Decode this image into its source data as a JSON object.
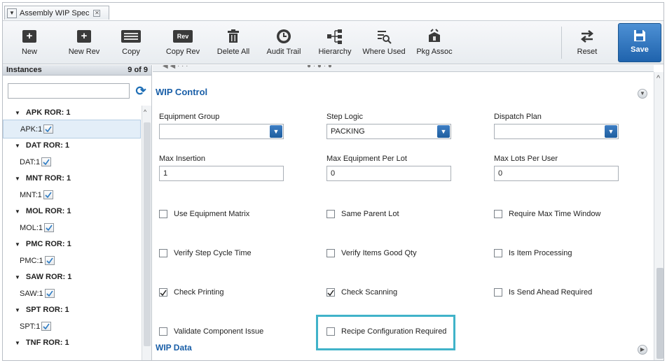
{
  "tab": {
    "title": "Assembly WIP Spec"
  },
  "toolbar": {
    "new": "New",
    "new_rev": "New Rev",
    "copy": "Copy",
    "copy_rev": "Copy Rev",
    "rev_badge": "Rev",
    "delete_all": "Delete All",
    "audit_trail": "Audit Trail",
    "hierarchy": "Hierarchy",
    "where_used": "Where Used",
    "pkg_assoc": "Pkg Assoc",
    "reset": "Reset",
    "save": "Save"
  },
  "instances": {
    "title": "Instances",
    "count": "9 of 9",
    "groups": [
      {
        "label": "APK ROR: 1",
        "item": "APK:1"
      },
      {
        "label": "DAT ROR: 1",
        "item": "DAT:1"
      },
      {
        "label": "MNT ROR: 1",
        "item": "MNT:1"
      },
      {
        "label": "MOL ROR: 1",
        "item": "MOL:1"
      },
      {
        "label": "PMC ROR: 1",
        "item": "PMC:1"
      },
      {
        "label": "SAW ROR: 1",
        "item": "SAW:1"
      },
      {
        "label": "SPT ROR: 1",
        "item": "SPT:1"
      },
      {
        "label": "TNF ROR: 1"
      }
    ]
  },
  "wip_control": {
    "title": "WIP Control",
    "equipment_group": {
      "label": "Equipment Group",
      "value": ""
    },
    "step_logic": {
      "label": "Step Logic",
      "value": "PACKING"
    },
    "dispatch_plan": {
      "label": "Dispatch Plan",
      "value": ""
    },
    "max_insertion": {
      "label": "Max Insertion",
      "value": "1"
    },
    "max_equipment_per_lot": {
      "label": "Max Equipment Per Lot",
      "value": "0"
    },
    "max_lots_per_user": {
      "label": "Max Lots Per User",
      "value": "0"
    },
    "checkboxes": {
      "use_equipment_matrix": {
        "label": "Use Equipment Matrix",
        "checked": false
      },
      "same_parent_lot": {
        "label": "Same Parent Lot",
        "checked": false
      },
      "require_max_time_window": {
        "label": "Require Max Time Window",
        "checked": false
      },
      "verify_step_cycle_time": {
        "label": "Verify Step Cycle Time",
        "checked": false
      },
      "verify_items_good_qty": {
        "label": "Verify Items Good Qty",
        "checked": false
      },
      "is_item_processing": {
        "label": "Is Item Processing",
        "checked": false
      },
      "check_printing": {
        "label": "Check Printing",
        "checked": true
      },
      "check_scanning": {
        "label": "Check Scanning",
        "checked": true
      },
      "is_send_ahead_required": {
        "label": "Is Send Ahead Required",
        "checked": false
      },
      "validate_component_issue": {
        "label": "Validate Component Issue",
        "checked": false
      },
      "recipe_configuration_required": {
        "label": "Recipe Configuration Required",
        "checked": false
      }
    }
  },
  "wip_data": {
    "title": "WIP Data"
  },
  "colors": {
    "accent": "#1a5fa8",
    "save": "#2f74bf",
    "highlight": "#40b3c9"
  }
}
